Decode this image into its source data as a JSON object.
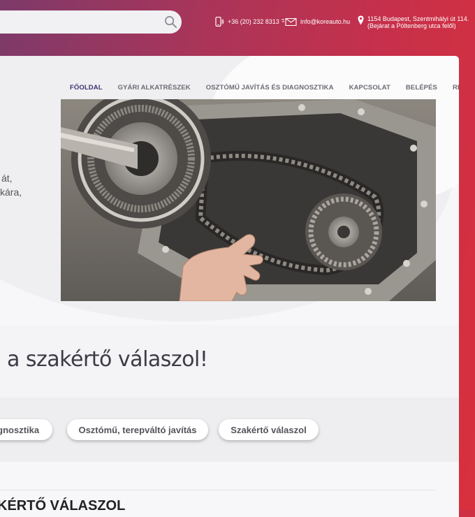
{
  "search": {
    "placeholder": ""
  },
  "contacts": {
    "phone": "+36 (20) 232 8313",
    "email": "info@koreauto.hu",
    "address_line1": "1154 Budapest, Szentmihályi út 114.",
    "address_line2": "(Bejárat a Pöltenberg utca felől)"
  },
  "nav": [
    {
      "label": "FŐOLDAL",
      "active": true
    },
    {
      "label": "GYÁRI ALKATRÉSZEK"
    },
    {
      "label": "OSZTÓMŰ JAVÍTÁS ÉS DIAGNOSZTIKA"
    },
    {
      "label": "KAPCSOLAT"
    },
    {
      "label": "BELÉPÉS"
    },
    {
      "label": "REGISZTRÁCIÓ"
    }
  ],
  "hero": {
    "text_line1": "át,",
    "text_line2": "kára,",
    "image": "transfer-case-gear-chain-photo"
  },
  "question": {
    "title": "a szakértő válaszol!"
  },
  "tabs": [
    {
      "label": "agnosztika"
    },
    {
      "label": "Osztómű, terepváltó javítás"
    },
    {
      "label": "Szakértő válaszol"
    }
  ],
  "section": {
    "title": "KÉRTŐ VÁLASZOL"
  },
  "colors": {
    "accent": "#c7304a",
    "nav_active": "#3a3570"
  }
}
